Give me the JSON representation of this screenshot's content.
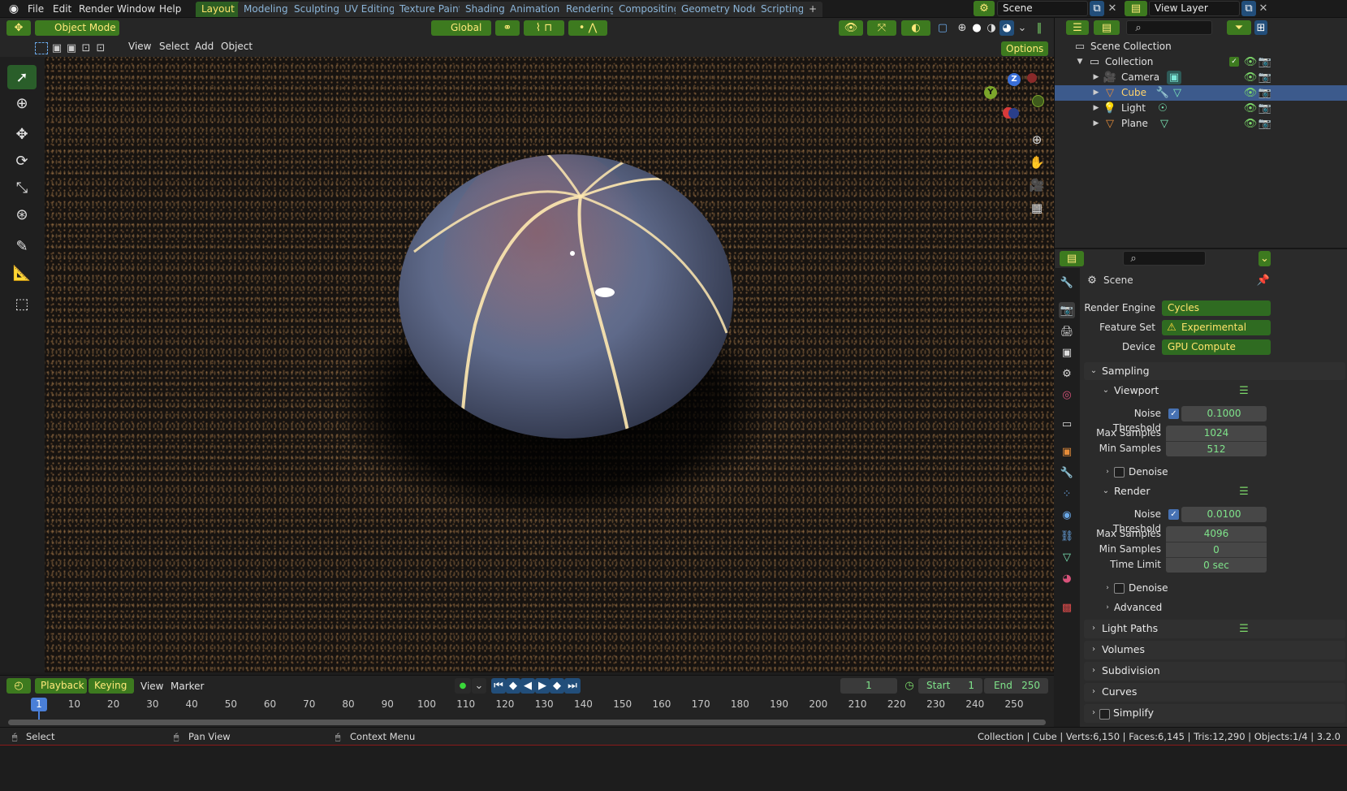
{
  "topbar": {
    "menus": [
      "File",
      "Edit",
      "Render",
      "Window",
      "Help"
    ],
    "workspaces": [
      "Layout",
      "Modeling",
      "Sculpting",
      "UV Editing",
      "Texture Paint",
      "Shading",
      "Animation",
      "Rendering",
      "Compositing",
      "Geometry Nodes",
      "Scripting"
    ],
    "active_workspace": "Layout",
    "scene_name": "Scene",
    "view_layer": "View Layer",
    "add_tab": "+"
  },
  "viewport_header": {
    "mode": "Object Mode",
    "menus": [
      "View",
      "Select",
      "Add",
      "Object"
    ],
    "orientation": "Global",
    "options": "Options"
  },
  "gizmo": {
    "z": "Z",
    "y": "Y"
  },
  "outliner": {
    "root": "Scene Collection",
    "collection": "Collection",
    "objects": [
      {
        "name": "Camera",
        "selected": false
      },
      {
        "name": "Cube",
        "selected": true
      },
      {
        "name": "Light",
        "selected": false
      },
      {
        "name": "Plane",
        "selected": false
      }
    ]
  },
  "properties": {
    "context": "Scene",
    "render_engine_label": "Render Engine",
    "render_engine": "Cycles",
    "feature_set_label": "Feature Set",
    "feature_set": "Experimental",
    "device_label": "Device",
    "device": "GPU Compute",
    "sampling": "Sampling",
    "viewport": {
      "title": "Viewport",
      "noise_threshold_label": "Noise Threshold",
      "noise_threshold": "0.1000",
      "max_samples_label": "Max Samples",
      "max_samples": "1024",
      "min_samples_label": "Min Samples",
      "min_samples": "512",
      "denoise": "Denoise"
    },
    "render": {
      "title": "Render",
      "noise_threshold_label": "Noise Threshold",
      "noise_threshold": "0.0100",
      "max_samples_label": "Max Samples",
      "max_samples": "4096",
      "min_samples_label": "Min Samples",
      "min_samples": "0",
      "time_limit_label": "Time Limit",
      "time_limit": "0 sec",
      "denoise": "Denoise",
      "advanced": "Advanced"
    },
    "panels": [
      "Light Paths",
      "Volumes",
      "Subdivision",
      "Curves",
      "Simplify"
    ]
  },
  "timeline": {
    "playback": "Playback",
    "keying": "Keying",
    "view": "View",
    "marker": "Marker",
    "current_frame": "1",
    "start_label": "Start",
    "start": "1",
    "end_label": "End",
    "end": "250",
    "ticks": [
      "1",
      "10",
      "20",
      "30",
      "40",
      "50",
      "60",
      "70",
      "80",
      "90",
      "100",
      "110",
      "120",
      "130",
      "140",
      "150",
      "160",
      "170",
      "180",
      "190",
      "200",
      "210",
      "220",
      "230",
      "240",
      "250"
    ]
  },
  "statusbar": {
    "select": "Select",
    "pan": "Pan View",
    "context": "Context Menu",
    "stats": "Collection | Cube | Verts:6,150 | Faces:6,145 | Tris:12,290 | Objects:1/4 | 3.2.0"
  },
  "colors": {
    "accent_green": "#2d5f23",
    "selection_blue": "#3c5a8c",
    "field_text": "#7fe38a"
  }
}
